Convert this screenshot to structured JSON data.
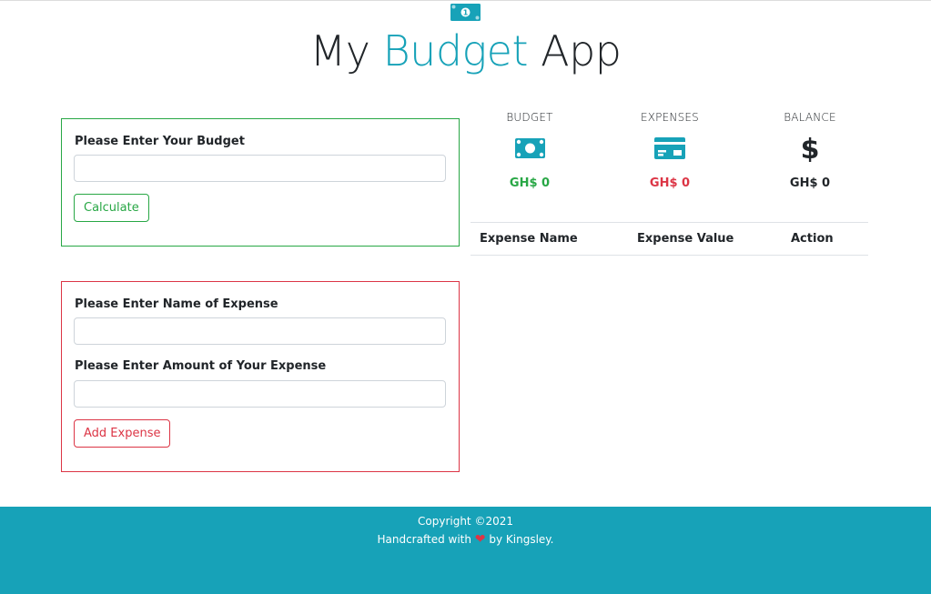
{
  "header": {
    "title_part1": "My",
    "title_accent": "Budget",
    "title_part2": "App",
    "icon": "money-bill-icon"
  },
  "budget_form": {
    "label": "Please Enter Your Budget",
    "input_value": "",
    "button_label": "Calculate"
  },
  "expense_form": {
    "name_label": "Please Enter Name of Expense",
    "name_value": "",
    "amount_label": "Please Enter Amount of Your Expense",
    "amount_value": "",
    "button_label": "Add Expense"
  },
  "stats": {
    "budget": {
      "label": "BUDGET",
      "amount": "GH$ 0",
      "icon": "money-bill-icon",
      "color": "#28a745"
    },
    "expenses": {
      "label": "EXPENSES",
      "amount": "GH$ 0",
      "icon": "credit-card-icon",
      "color": "#dc3545"
    },
    "balance": {
      "label": "BALANCE",
      "amount": "GH$ 0",
      "icon": "dollar-sign-icon",
      "color": "#212529"
    }
  },
  "table": {
    "headers": [
      "Expense Name",
      "Expense Value",
      "Action"
    ],
    "rows": []
  },
  "footer": {
    "copyright": "Copyright ©2021",
    "handcrafted_prefix": "Handcrafted with",
    "handcrafted_suffix": "by Kingsley."
  },
  "colors": {
    "accent": "#17a2b8",
    "success": "#28a745",
    "danger": "#dc3545"
  }
}
